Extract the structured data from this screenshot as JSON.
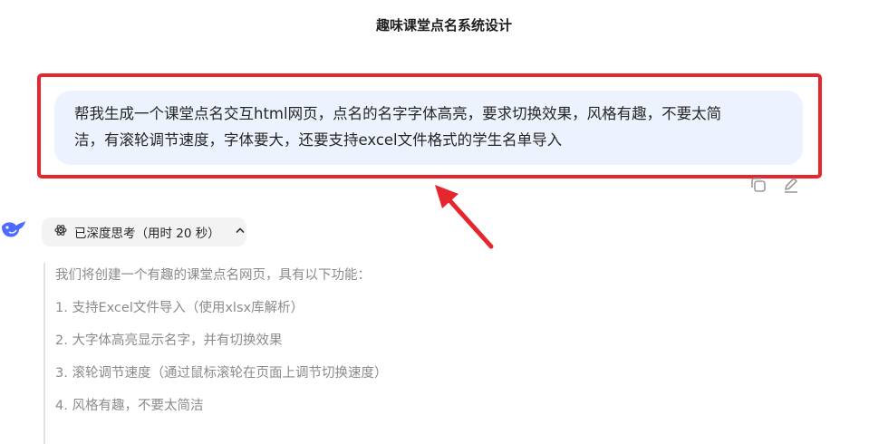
{
  "header": {
    "title": "趣味课堂点名系统设计"
  },
  "user_message": {
    "line1": "帮我生成一个课堂点名交互html网页，点名的名字字体高亮，要求切换效果，风格有趣，不要太简",
    "line2": "洁，有滚轮调节速度，字体要大，还要支持excel文件格式的学生名单导入"
  },
  "annotation": {
    "box_color": "#e5262c",
    "arrow_color": "#e5262c"
  },
  "message_actions": [
    {
      "icon": "copy-icon"
    },
    {
      "icon": "edit-icon"
    }
  ],
  "assistant": {
    "avatar_icon": "deepseek-whale-icon",
    "thinking_toggle": {
      "icon": "atom-icon",
      "label": "已深度思考（用时 20 秒）",
      "chevron": "chevron-up-icon"
    },
    "thinking": {
      "intro": "我们将创建一个有趣的课堂点名网页，具有以下功能：",
      "items": [
        "1. 支持Excel文件导入（使用xlsx库解析）",
        "2. 大字体高亮显示名字，并有切换效果",
        "3. 滚轮调节速度（通过鼠标滚轮在页面上调节切换速度）",
        "4. 风格有趣，不要太简洁"
      ]
    }
  }
}
